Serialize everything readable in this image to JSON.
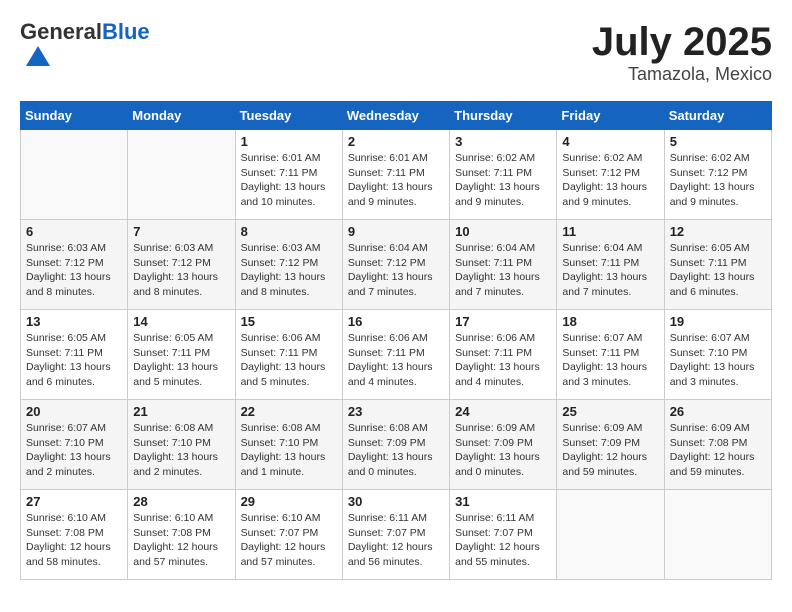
{
  "header": {
    "logo_general": "General",
    "logo_blue": "Blue",
    "month": "July 2025",
    "location": "Tamazola, Mexico"
  },
  "days_of_week": [
    "Sunday",
    "Monday",
    "Tuesday",
    "Wednesday",
    "Thursday",
    "Friday",
    "Saturday"
  ],
  "weeks": [
    [
      {
        "day": "",
        "detail": ""
      },
      {
        "day": "",
        "detail": ""
      },
      {
        "day": "1",
        "detail": "Sunrise: 6:01 AM\nSunset: 7:11 PM\nDaylight: 13 hours and 10 minutes."
      },
      {
        "day": "2",
        "detail": "Sunrise: 6:01 AM\nSunset: 7:11 PM\nDaylight: 13 hours and 9 minutes."
      },
      {
        "day": "3",
        "detail": "Sunrise: 6:02 AM\nSunset: 7:11 PM\nDaylight: 13 hours and 9 minutes."
      },
      {
        "day": "4",
        "detail": "Sunrise: 6:02 AM\nSunset: 7:12 PM\nDaylight: 13 hours and 9 minutes."
      },
      {
        "day": "5",
        "detail": "Sunrise: 6:02 AM\nSunset: 7:12 PM\nDaylight: 13 hours and 9 minutes."
      }
    ],
    [
      {
        "day": "6",
        "detail": "Sunrise: 6:03 AM\nSunset: 7:12 PM\nDaylight: 13 hours and 8 minutes."
      },
      {
        "day": "7",
        "detail": "Sunrise: 6:03 AM\nSunset: 7:12 PM\nDaylight: 13 hours and 8 minutes."
      },
      {
        "day": "8",
        "detail": "Sunrise: 6:03 AM\nSunset: 7:12 PM\nDaylight: 13 hours and 8 minutes."
      },
      {
        "day": "9",
        "detail": "Sunrise: 6:04 AM\nSunset: 7:12 PM\nDaylight: 13 hours and 7 minutes."
      },
      {
        "day": "10",
        "detail": "Sunrise: 6:04 AM\nSunset: 7:11 PM\nDaylight: 13 hours and 7 minutes."
      },
      {
        "day": "11",
        "detail": "Sunrise: 6:04 AM\nSunset: 7:11 PM\nDaylight: 13 hours and 7 minutes."
      },
      {
        "day": "12",
        "detail": "Sunrise: 6:05 AM\nSunset: 7:11 PM\nDaylight: 13 hours and 6 minutes."
      }
    ],
    [
      {
        "day": "13",
        "detail": "Sunrise: 6:05 AM\nSunset: 7:11 PM\nDaylight: 13 hours and 6 minutes."
      },
      {
        "day": "14",
        "detail": "Sunrise: 6:05 AM\nSunset: 7:11 PM\nDaylight: 13 hours and 5 minutes."
      },
      {
        "day": "15",
        "detail": "Sunrise: 6:06 AM\nSunset: 7:11 PM\nDaylight: 13 hours and 5 minutes."
      },
      {
        "day": "16",
        "detail": "Sunrise: 6:06 AM\nSunset: 7:11 PM\nDaylight: 13 hours and 4 minutes."
      },
      {
        "day": "17",
        "detail": "Sunrise: 6:06 AM\nSunset: 7:11 PM\nDaylight: 13 hours and 4 minutes."
      },
      {
        "day": "18",
        "detail": "Sunrise: 6:07 AM\nSunset: 7:11 PM\nDaylight: 13 hours and 3 minutes."
      },
      {
        "day": "19",
        "detail": "Sunrise: 6:07 AM\nSunset: 7:10 PM\nDaylight: 13 hours and 3 minutes."
      }
    ],
    [
      {
        "day": "20",
        "detail": "Sunrise: 6:07 AM\nSunset: 7:10 PM\nDaylight: 13 hours and 2 minutes."
      },
      {
        "day": "21",
        "detail": "Sunrise: 6:08 AM\nSunset: 7:10 PM\nDaylight: 13 hours and 2 minutes."
      },
      {
        "day": "22",
        "detail": "Sunrise: 6:08 AM\nSunset: 7:10 PM\nDaylight: 13 hours and 1 minute."
      },
      {
        "day": "23",
        "detail": "Sunrise: 6:08 AM\nSunset: 7:09 PM\nDaylight: 13 hours and 0 minutes."
      },
      {
        "day": "24",
        "detail": "Sunrise: 6:09 AM\nSunset: 7:09 PM\nDaylight: 13 hours and 0 minutes."
      },
      {
        "day": "25",
        "detail": "Sunrise: 6:09 AM\nSunset: 7:09 PM\nDaylight: 12 hours and 59 minutes."
      },
      {
        "day": "26",
        "detail": "Sunrise: 6:09 AM\nSunset: 7:08 PM\nDaylight: 12 hours and 59 minutes."
      }
    ],
    [
      {
        "day": "27",
        "detail": "Sunrise: 6:10 AM\nSunset: 7:08 PM\nDaylight: 12 hours and 58 minutes."
      },
      {
        "day": "28",
        "detail": "Sunrise: 6:10 AM\nSunset: 7:08 PM\nDaylight: 12 hours and 57 minutes."
      },
      {
        "day": "29",
        "detail": "Sunrise: 6:10 AM\nSunset: 7:07 PM\nDaylight: 12 hours and 57 minutes."
      },
      {
        "day": "30",
        "detail": "Sunrise: 6:11 AM\nSunset: 7:07 PM\nDaylight: 12 hours and 56 minutes."
      },
      {
        "day": "31",
        "detail": "Sunrise: 6:11 AM\nSunset: 7:07 PM\nDaylight: 12 hours and 55 minutes."
      },
      {
        "day": "",
        "detail": ""
      },
      {
        "day": "",
        "detail": ""
      }
    ]
  ]
}
